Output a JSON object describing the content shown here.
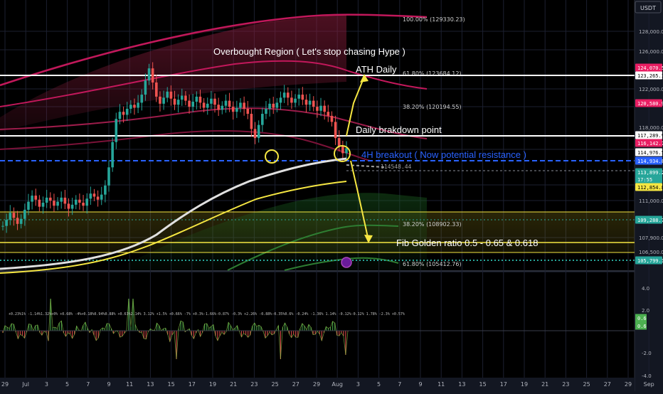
{
  "chart_data": {
    "type": "candlestick",
    "title": "",
    "currency_label": "USDT",
    "x_tick_labels": [
      "29",
      "Jul",
      "3",
      "5",
      "7",
      "9",
      "11",
      "13",
      "15",
      "17",
      "19",
      "21",
      "23",
      "25",
      "27",
      "29",
      "Aug",
      "3",
      "5",
      "7",
      "9",
      "11",
      "13",
      "15",
      "17",
      "19",
      "21",
      "23",
      "25",
      "27",
      "29",
      "Sep"
    ],
    "y_tick_labels": [
      "128,000.0",
      "126,000.0",
      "122,000.0",
      "118,000.0",
      "111,000.0",
      "107,900.0",
      "106,500.0"
    ],
    "price_tags": [
      {
        "value": "124,070.5",
        "color": "#e91e63"
      },
      {
        "value": "123,265.3",
        "color": "#ffffff"
      },
      {
        "value": "120,580.9",
        "color": "#e91e63"
      },
      {
        "value": "117,289.9",
        "color": "#ffffff"
      },
      {
        "value": "116,142.7",
        "color": "#e91e63"
      },
      {
        "value": "114,976.5",
        "color": "#ffffff"
      },
      {
        "value": "114,934.8",
        "color": "#2962ff"
      },
      {
        "value": "113,899.2",
        "color": "#26a69a"
      },
      {
        "value": "17:55",
        "color": "#26a69a"
      },
      {
        "value": "112,854.8",
        "color": "#f5e642"
      },
      {
        "value": "109,288.7",
        "color": "#26a69a"
      },
      {
        "value": "105,799.1",
        "color": "#26a69a"
      }
    ],
    "fib_levels": [
      {
        "label": "100.00%",
        "value": "(129330.23)"
      },
      {
        "label": "61.80%",
        "value": "(123684.12)"
      },
      {
        "label": "38.20%",
        "value": "(120194.55)"
      },
      {
        "label": "38.20%",
        "value": "(108902.33)"
      },
      {
        "label": "61.80%",
        "value": "(105412.76)"
      }
    ],
    "annotations": {
      "overbought": "Overbought Region ( Let's stop chasing Hype )",
      "ath": "ATH Daily",
      "breakdown": "Daily brakdown point",
      "breakout": "4H breakout ( Now potential resistance )",
      "fib_golden": "Fib Golden ratio 0.5  - 0.65 & 0.618",
      "mid_price": "114548.44"
    },
    "indicator": {
      "y_tick_labels": [
        "4.0",
        "2.0",
        "-2.0",
        "-4.0"
      ],
      "tags": [
        {
          "value": "0.6",
          "color": "#4caf50"
        },
        {
          "value": "0.6",
          "color": "#4caf50"
        }
      ],
      "percent_row": "+0.23%1% -1.14%1.32%+0% +0.68% -4%+0.18%0.94%0.88% +0.63%2.14% 3.12% +1.5% +0.66% -7% +0.3%-1.66%-0.87% -0.3% +2.26% -0.88%-0.35%0.6% -0.24% -1.36% 1.14% -0.12%-0.12% 1.78% -2.3% +0.57%"
    },
    "close_series": [
      106.2,
      106.8,
      107.5,
      107.0,
      106.4,
      106.9,
      107.8,
      108.6,
      109.2,
      108.8,
      108.1,
      108.5,
      109.0,
      108.7,
      108.2,
      108.6,
      109.0,
      108.4,
      107.9,
      108.3,
      108.8,
      108.5,
      108.2,
      108.9,
      109.4,
      109.1,
      108.8,
      109.3,
      110.2,
      112.0,
      114.5,
      116.8,
      117.5,
      117.2,
      117.8,
      118.2,
      117.9,
      118.4,
      119.2,
      120.6,
      121.8,
      120.4,
      119.0,
      118.3,
      118.9,
      119.5,
      118.8,
      118.2,
      118.7,
      119.1,
      118.6,
      118.0,
      118.5,
      119.0,
      118.4,
      117.9,
      118.3,
      118.8,
      118.2,
      117.7,
      118.1,
      118.6,
      118.0,
      117.5,
      117.9,
      118.4,
      117.8,
      117.3,
      115.8,
      114.9,
      116.2,
      117.3,
      117.8,
      118.3,
      117.9,
      118.4,
      118.9,
      119.4,
      118.9,
      118.4,
      118.8,
      119.2,
      118.7,
      118.2,
      118.6,
      118.0,
      117.6,
      118.1,
      117.5,
      117.1,
      116.5,
      114.9,
      114.1,
      113.4,
      113.9
    ]
  }
}
